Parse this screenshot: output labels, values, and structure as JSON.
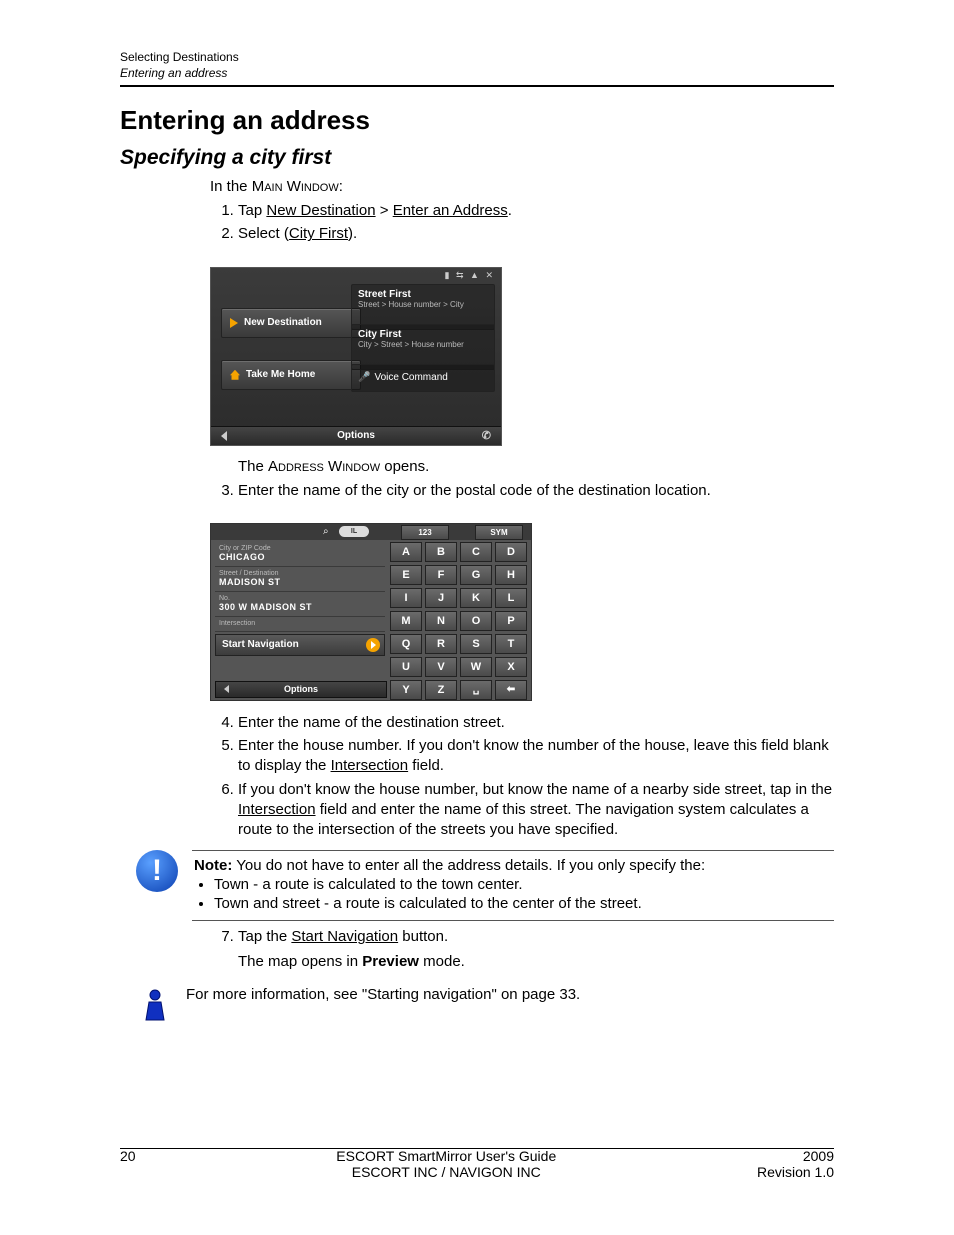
{
  "header": {
    "chapter": "Selecting Destinations",
    "section": "Entering an address"
  },
  "title": "Entering an address",
  "subtitle": "Specifying a city first",
  "lead_prefix": "In the ",
  "lead_smallcaps": "Main Window",
  "lead_suffix": ":",
  "step1_a": "Tap ",
  "step1_u1": "New Destination",
  "step1_b": " > ",
  "step1_u2": "Enter an Address",
  "step1_c": ".",
  "step2_a": "Select (",
  "step2_u": "City First",
  "step2_b": ").",
  "after_shot1_a": "The ",
  "after_shot1_sc": "Address Window",
  "after_shot1_b": " opens.",
  "step3": "Enter the name of the city or the postal code of the destination location.",
  "step4": "Enter the name of the destination street.",
  "step5_a": "Enter the house number. If you don't know the number of the house, leave this field blank to display the ",
  "step5_u": "Intersection",
  "step5_b": " field.",
  "step6_a": "If you don't know the house number, but know the name of a nearby side street, tap in the ",
  "step6_u": "Intersection",
  "step6_b": " field and enter the name of this street. The navigation system calculates a route to the intersection of the streets you have specified.",
  "note_lead": "Note:",
  "note_body": " You do not have to enter all the address details. If you only specify the:",
  "note_li1": "Town - a route is calculated to the town center.",
  "note_li2": "Town and street - a route is calculated to the center of the street.",
  "step7_a": "Tap the ",
  "step7_u": "Start Navigation",
  "step7_b": " button.",
  "step7_sub_a": "The map opens in ",
  "step7_sub_bold": "Preview",
  "step7_sub_b": " mode.",
  "info_text": "For more information, see \"Starting navigation\" on page 33.",
  "shot1": {
    "status": "▮ ⇆ ▲ ✕",
    "new_destination": "New Destination",
    "take_me_home": "Take Me Home",
    "street_first_t": "Street First",
    "street_first_d": "Street > House number > City",
    "city_first_t": "City First",
    "city_first_d": "City > Street > House number",
    "voice_cmd": "Voice Command",
    "options": "Options"
  },
  "shot2": {
    "pill": "IL",
    "tab_123": "123",
    "tab_sym": "SYM",
    "f_city_l": "City or ZIP Code",
    "f_city_v": "CHICAGO",
    "f_street_l": "Street / Destination",
    "f_street_v": "MADISON ST",
    "f_no_l": "No.",
    "f_no_v": "300 W MADISON ST",
    "f_int_l": "Intersection",
    "f_int_v": "",
    "start_nav": "Start Navigation",
    "options": "Options",
    "keys": [
      "A",
      "B",
      "C",
      "D",
      "E",
      "F",
      "G",
      "H",
      "I",
      "J",
      "K",
      "L",
      "M",
      "N",
      "O",
      "P",
      "Q",
      "R",
      "S",
      "T",
      "U",
      "V",
      "W",
      "X",
      "Y",
      "Z"
    ]
  },
  "footer": {
    "page": "20",
    "mid1": "ESCORT SmartMirror User's Guide",
    "mid2": "ESCORT INC / NAVIGON INC",
    "year": "2009",
    "rev": "Revision 1.0"
  }
}
